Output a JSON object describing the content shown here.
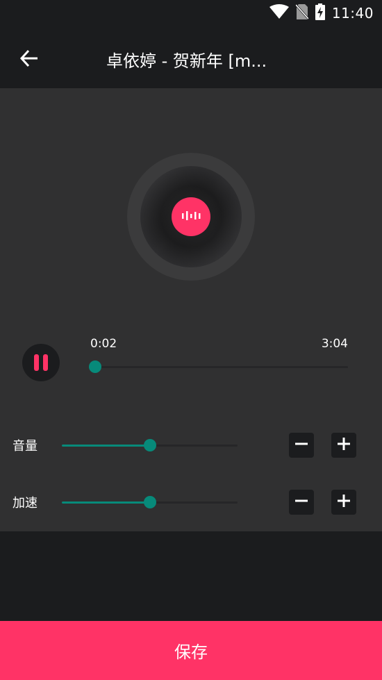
{
  "status_bar": {
    "time": "11:40",
    "icons": [
      "wifi-icon",
      "no-sim-icon",
      "battery-charging-icon"
    ]
  },
  "app_bar": {
    "back_icon": "arrow-left-icon",
    "title": "卓依婷 - 贺新年 [m..."
  },
  "player": {
    "disc_icon": "audio-wave-icon",
    "accent_color": "#ff3366",
    "current_time": "0:02",
    "total_time": "3:04",
    "progress_fraction": 0.0,
    "pause_icon": "pause-icon"
  },
  "controls": [
    {
      "label": "音量",
      "value_fraction": 0.5,
      "minus_icon": "minus-icon",
      "plus_icon": "plus-icon"
    },
    {
      "label": "加速",
      "value_fraction": 0.5,
      "minus_icon": "minus-icon",
      "plus_icon": "plus-icon"
    }
  ],
  "slider_color": "#078a7a",
  "save_button": {
    "label": "保存"
  }
}
